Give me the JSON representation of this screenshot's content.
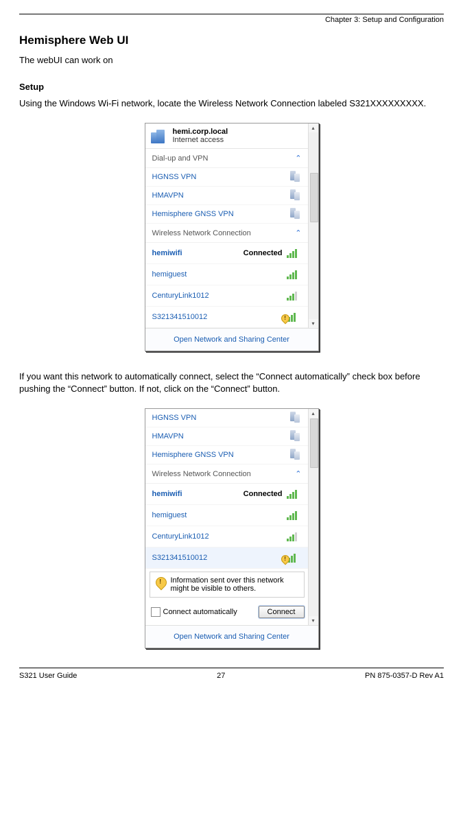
{
  "header": {
    "chapter": "Chapter 3: Setup and Configuration"
  },
  "title": "Hemisphere Web UI",
  "intro": "The webUI can work on",
  "setup_heading": "Setup",
  "setup_text": "Using the Windows Wi-Fi network, locate the Wireless Network Connection labeled S321XXXXXXXXX.",
  "midtext": "If you want this network to automatically connect, select the “Connect automatically” check box before pushing the “Connect” button. If not, click on the “Connect” button.",
  "panel1": {
    "host": "hemi.corp.local",
    "host_sub": "Internet access",
    "dial_section": "Dial-up and VPN",
    "vpn": [
      "HGNSS VPN",
      "HMAVPN",
      "Hemisphere GNSS VPN"
    ],
    "wnc_section": "Wireless Network Connection",
    "wifi": [
      {
        "name": "hemiwifi",
        "status": "Connected",
        "bold": true
      },
      {
        "name": "hemiguest"
      },
      {
        "name": "CenturyLink1012"
      },
      {
        "name": "S321341510012",
        "warn": true
      }
    ],
    "footer": "Open Network and Sharing Center"
  },
  "panel2": {
    "vpn": [
      "HGNSS VPN",
      "HMAVPN",
      "Hemisphere GNSS VPN"
    ],
    "wnc_section": "Wireless Network Connection",
    "wifi": [
      {
        "name": "hemiwifi",
        "status": "Connected",
        "bold": true
      },
      {
        "name": "hemiguest"
      },
      {
        "name": "CenturyLink1012"
      },
      {
        "name": "S321341510012",
        "warn": true,
        "selected": true
      }
    ],
    "info": "Information sent over this network might be visible to others.",
    "auto_label": "Connect automatically",
    "connect_btn": "Connect",
    "footer": "Open Network and Sharing Center"
  },
  "footer": {
    "left": "S321 User Guide",
    "center": "27",
    "right": "PN 875-0357-D Rev A1"
  }
}
